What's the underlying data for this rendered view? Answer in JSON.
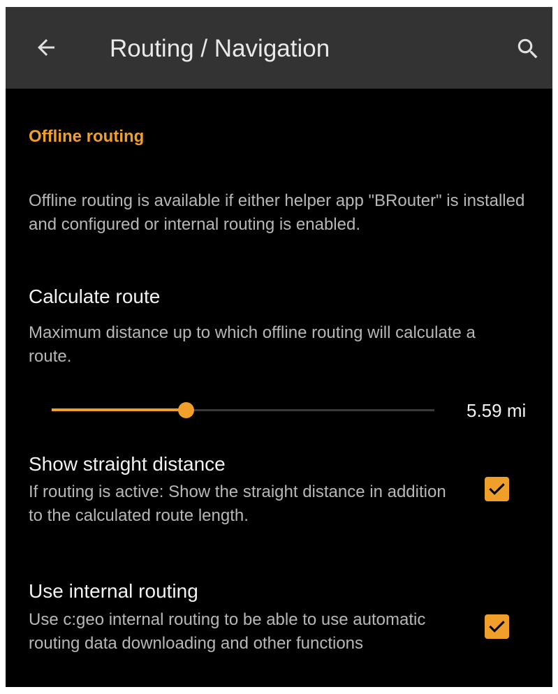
{
  "header": {
    "title": "Routing / Navigation",
    "back_icon": "arrow-back-icon",
    "search_icon": "search-icon"
  },
  "section": {
    "title": "Offline routing",
    "info": "Offline routing is available if either helper app \"BRouter\" is installed and configured or internal routing is enabled."
  },
  "calculate_route": {
    "title": "Calculate route",
    "summary": "Maximum distance up to which offline routing will calculate a route.",
    "slider_fraction": 0.35,
    "value_label": "5.59 mi"
  },
  "straight_distance": {
    "title": "Show straight distance",
    "summary": "If routing is active: Show the straight distance in addition to the calculated route length.",
    "checked": true
  },
  "internal_routing": {
    "title": "Use internal routing",
    "summary": "Use c:geo internal routing to be able to use automatic routing data downloading and other functions",
    "checked": true
  },
  "colors": {
    "accent": "#f0a02a",
    "toolbar": "#333333",
    "background": "#000000",
    "primary_text": "#f2f2f2",
    "secondary_text": "#b7b7b7"
  }
}
